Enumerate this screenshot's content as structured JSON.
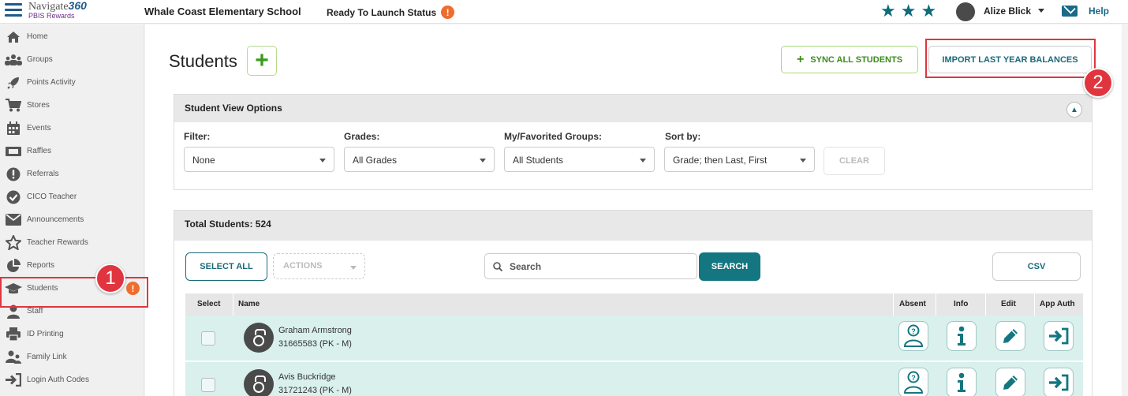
{
  "topbar": {
    "brand": "Navigate",
    "brand_num": "360",
    "brand_sub": "PBIS Rewards",
    "school": "Whale Coast Elementary School",
    "launch_status": "Ready To Launch Status",
    "alert_glyph": "!",
    "user_name": "Alize Blick",
    "help": "Help"
  },
  "sidebar": {
    "items": [
      {
        "label": "Home",
        "icon": "home-icon"
      },
      {
        "label": "Groups",
        "icon": "groups-icon"
      },
      {
        "label": "Points Activity",
        "icon": "rocket-icon"
      },
      {
        "label": "Stores",
        "icon": "cart-icon"
      },
      {
        "label": "Events",
        "icon": "calendar-icon"
      },
      {
        "label": "Raffles",
        "icon": "ticket-icon"
      },
      {
        "label": "Referrals",
        "icon": "exclamation-icon"
      },
      {
        "label": "CICO Teacher",
        "icon": "check-circle-icon"
      },
      {
        "label": "Announcements",
        "icon": "envelope-icon"
      },
      {
        "label": "Teacher Rewards",
        "icon": "star-outline-icon"
      },
      {
        "label": "Reports",
        "icon": "pie-chart-icon"
      },
      {
        "label": "Students",
        "icon": "graduation-cap-icon"
      },
      {
        "label": "Staff",
        "icon": "person-icon"
      },
      {
        "label": "ID Printing",
        "icon": "printer-icon"
      },
      {
        "label": "Family Link",
        "icon": "family-icon"
      },
      {
        "label": "Login Auth Codes",
        "icon": "sign-in-icon"
      }
    ]
  },
  "annotations": {
    "badge1": "1",
    "badge2": "2"
  },
  "page": {
    "title": "Students",
    "add_glyph": "+",
    "sync_label": "SYNC ALL STUDENTS",
    "import_label": "IMPORT LAST YEAR BALANCES"
  },
  "view_options": {
    "title": "Student View Options",
    "filter_label": "Filter:",
    "filter_value": "None",
    "grades_label": "Grades:",
    "grades_value": "All Grades",
    "groups_label": "My/Favorited Groups:",
    "groups_value": "All Students",
    "sort_label": "Sort by:",
    "sort_value": "Grade; then Last, First",
    "clear_label": "CLEAR"
  },
  "students": {
    "total_label": "Total Students: 524",
    "select_all": "SELECT ALL",
    "actions": "ACTIONS",
    "search_placeholder": "Search",
    "search_button": "SEARCH",
    "csv": "CSV",
    "columns": [
      "Select",
      "Name",
      "Absent",
      "Info",
      "Edit",
      "App Auth"
    ],
    "rows": [
      {
        "name": "Graham Armstrong",
        "id": "31665583 (PK - M)"
      },
      {
        "name": "Avis Buckridge",
        "id": "31721243 (PK - M)"
      }
    ]
  },
  "colors": {
    "accent_teal": "#137680",
    "alert_orange": "#ef6c2d",
    "annotation_red": "#e0353f",
    "row_bg": "#d9f0ed"
  }
}
